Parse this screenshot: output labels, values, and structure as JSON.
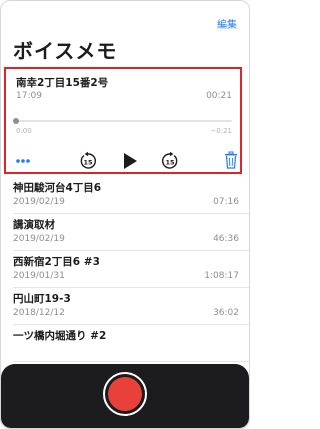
{
  "header": {
    "edit_label": "編集",
    "title": "ボイスメモ"
  },
  "player": {
    "title": "南幸2丁目15番2号",
    "date": "17:09",
    "duration": "00:21",
    "time_elapsed": "0:00",
    "time_remaining": "−0:21",
    "progress": 0.0,
    "skip_back_seconds": "15",
    "skip_forward_seconds": "15",
    "icons": {
      "more": "ellipsis-icon",
      "skip_back": "skip-back-15-icon",
      "play": "play-icon",
      "skip_forward": "skip-forward-15-icon",
      "delete": "trash-icon"
    }
  },
  "recordings": [
    {
      "name": "神田駿河台4丁目6",
      "date": "2019/02/19",
      "duration": "07:16"
    },
    {
      "name": "講演取材",
      "date": "2019/02/19",
      "duration": "46:36"
    },
    {
      "name": "西新宿2丁目6 #3",
      "date": "2019/01/31",
      "duration": "1:08:17"
    },
    {
      "name": "円山町19-3",
      "date": "2018/12/12",
      "duration": "36:02"
    },
    {
      "name": "一ツ橋内堀通り #2",
      "date": "",
      "duration": ""
    }
  ],
  "colors": {
    "accent": "#1a7cf5",
    "highlight_border": "#d9252c",
    "record": "#e9413a",
    "bottom_bar": "#1c1c1e"
  }
}
